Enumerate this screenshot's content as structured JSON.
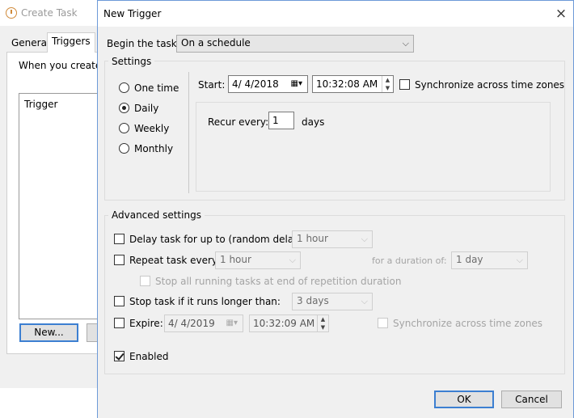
{
  "background_window": {
    "title": "Create Task",
    "tabs": [
      "General",
      "Triggers"
    ],
    "description": "When you create a",
    "list_header": "Trigger",
    "new_button": "New..."
  },
  "dialog": {
    "title": "New Trigger",
    "close_glyph": "×",
    "begin_label": "Begin the task:",
    "begin_value": "On a schedule",
    "settings": {
      "label": "Settings",
      "radios": [
        {
          "label": "One time",
          "checked": false
        },
        {
          "label": "Daily",
          "checked": true
        },
        {
          "label": "Weekly",
          "checked": false
        },
        {
          "label": "Monthly",
          "checked": false
        }
      ],
      "start_label": "Start:",
      "start_date": "4/ 4/2018",
      "start_time": "10:32:08 AM",
      "sync_label": "Synchronize across time zones",
      "recur_label": "Recur every:",
      "recur_value": "1",
      "recur_unit": "days"
    },
    "advanced": {
      "label": "Advanced settings",
      "delay_label": "Delay task for up to (random delay):",
      "delay_value": "1 hour",
      "repeat_label": "Repeat task every:",
      "repeat_value": "1 hour",
      "duration_label": "for a duration of:",
      "duration_value": "1 day",
      "stop_all_label": "Stop all running tasks at end of repetition duration",
      "stop_label": "Stop task if it runs longer than:",
      "stop_value": "3 days",
      "expire_label": "Expire:",
      "expire_date": "4/ 4/2019",
      "expire_time": "10:32:09 AM",
      "expire_sync_label": "Synchronize across time zones",
      "enabled_label": "Enabled",
      "enabled_checked": true
    },
    "ok_button": "OK",
    "cancel_button": "Cancel"
  },
  "colors": {
    "accent": "#3c7fd1",
    "dialog_bg": "#f0f0f0"
  },
  "icons": [
    "clock-icon",
    "calendar-icon",
    "chevron-down-icon",
    "spin-up-icon",
    "spin-down-icon",
    "close-icon"
  ]
}
